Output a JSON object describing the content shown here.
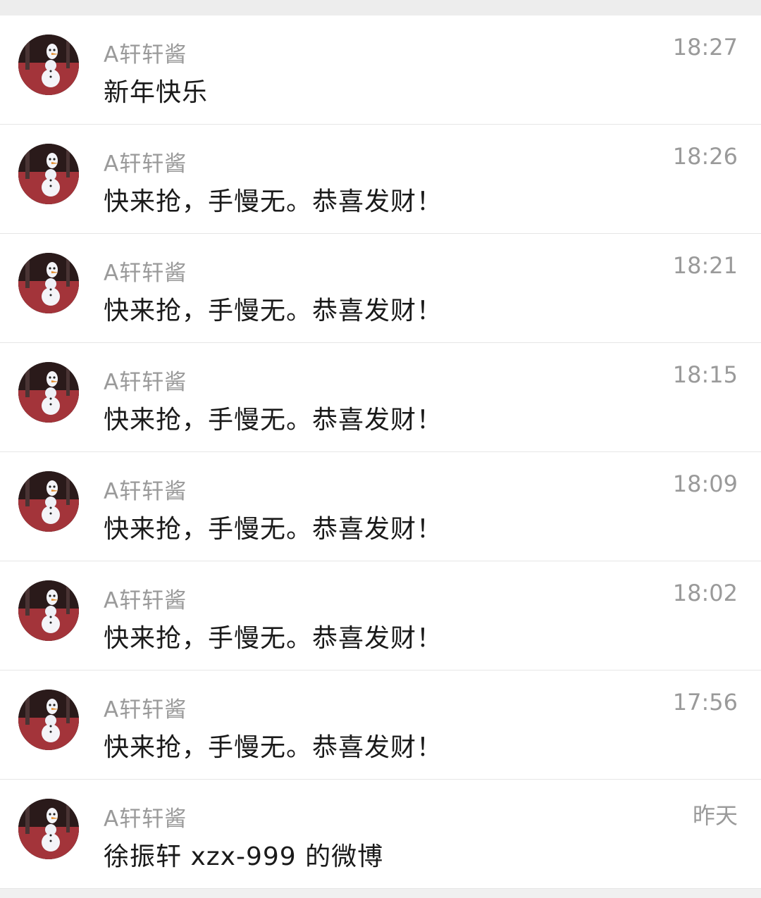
{
  "conversations": [
    {
      "name": "A轩轩酱",
      "message": "新年快乐",
      "time": "18:27"
    },
    {
      "name": "A轩轩酱",
      "message": "快来抢，手慢无。恭喜发财！",
      "time": "18:26"
    },
    {
      "name": "A轩轩酱",
      "message": "快来抢，手慢无。恭喜发财！",
      "time": "18:21"
    },
    {
      "name": "A轩轩酱",
      "message": "快来抢，手慢无。恭喜发财！",
      "time": "18:15"
    },
    {
      "name": "A轩轩酱",
      "message": "快来抢，手慢无。恭喜发财！",
      "time": "18:09"
    },
    {
      "name": "A轩轩酱",
      "message": "快来抢，手慢无。恭喜发财！",
      "time": "18:02"
    },
    {
      "name": "A轩轩酱",
      "message": "快来抢，手慢无。恭喜发财！",
      "time": "17:56"
    },
    {
      "name": "A轩轩酱",
      "message": "徐振轩 xzx-999 的微博",
      "time": "昨天"
    }
  ],
  "avatar_icon": "snowman-avatar-icon",
  "colors": {
    "name": "#9a9a9a",
    "message": "#1a1a1a",
    "time": "#9a9a9a",
    "divider": "#e6e6e6"
  }
}
